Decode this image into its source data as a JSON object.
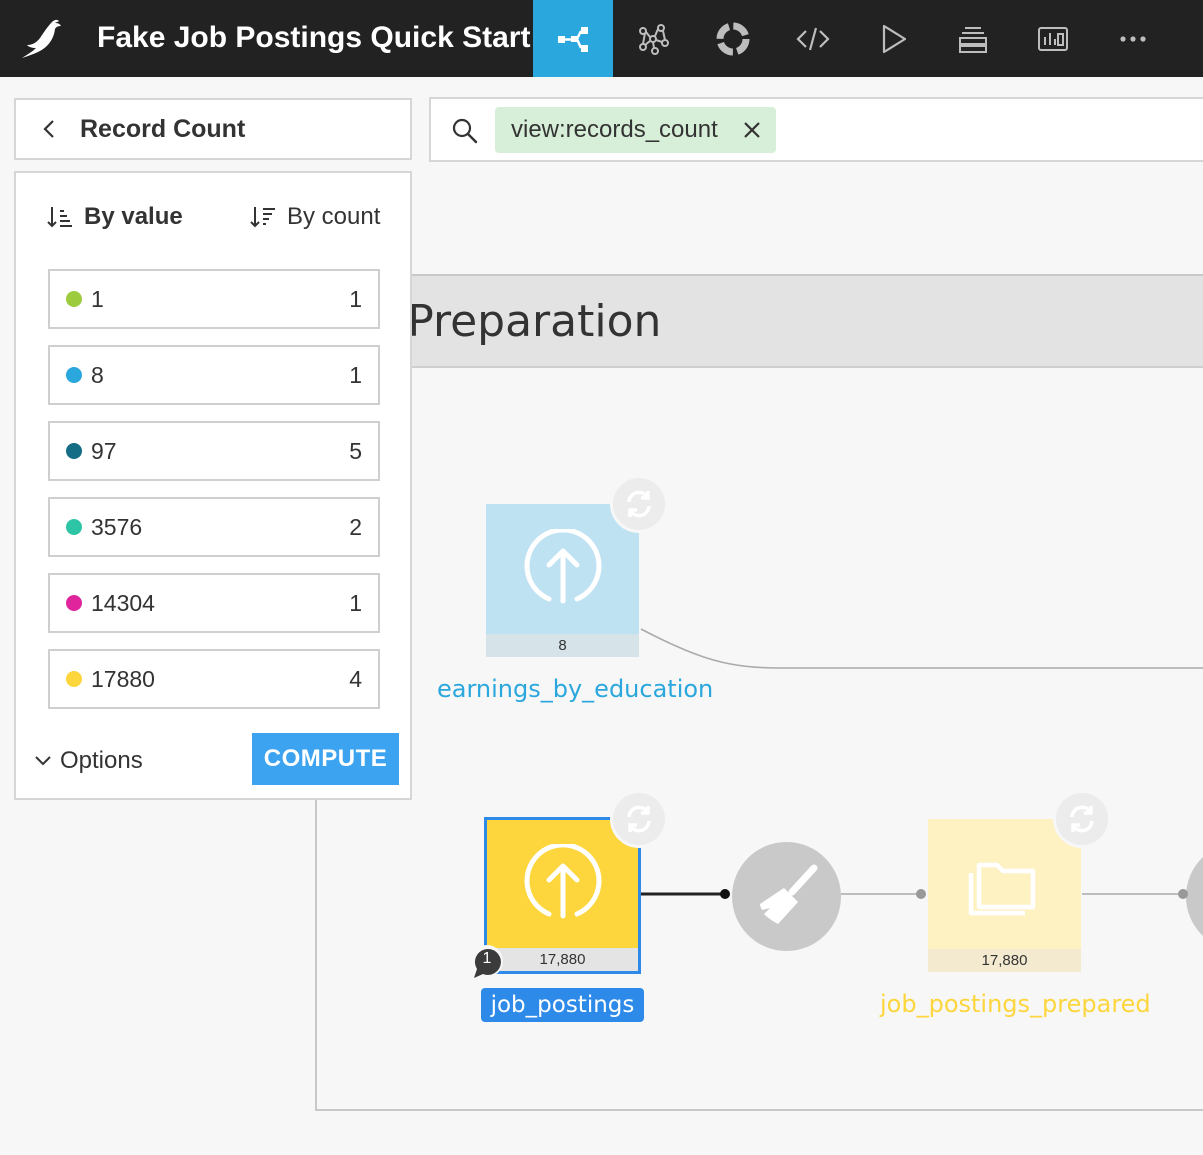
{
  "header": {
    "project_title": "Fake Job Postings Quick Start",
    "nav": [
      {
        "id": "flow",
        "icon": "flow-icon",
        "active": true
      },
      {
        "id": "lab",
        "icon": "lab-network-icon",
        "active": false
      },
      {
        "id": "jobs",
        "icon": "lifebuoy-icon",
        "active": false
      },
      {
        "id": "code",
        "icon": "code-icon",
        "active": false
      },
      {
        "id": "run",
        "icon": "play-icon",
        "active": false
      },
      {
        "id": "wiki",
        "icon": "stack-icon",
        "active": false
      },
      {
        "id": "dashboards",
        "icon": "dashboard-icon",
        "active": false
      },
      {
        "id": "more",
        "icon": "more-icon",
        "active": false
      }
    ]
  },
  "panel": {
    "title": "Record Count",
    "sort_by_value": "By value",
    "sort_by_count": "By count",
    "values": [
      {
        "label": "1",
        "count": "1",
        "color": "#9ccc3d"
      },
      {
        "label": "8",
        "count": "1",
        "color": "#2aa7dd"
      },
      {
        "label": "97",
        "count": "5",
        "color": "#156c85"
      },
      {
        "label": "3576",
        "count": "2",
        "color": "#2ec5a7"
      },
      {
        "label": "14304",
        "count": "1",
        "color": "#e0259c"
      },
      {
        "label": "17880",
        "count": "4",
        "color": "#fcd63c"
      }
    ],
    "options_label": "Options",
    "compute_label": "COMPUTE"
  },
  "search": {
    "chip": "view:records_count"
  },
  "flow": {
    "zone_title": "ta Preparation",
    "datasets": [
      {
        "name": "earnings_by_education",
        "count": "8",
        "color": "#2aa7dd"
      },
      {
        "name": "job_postings",
        "count": "17,880",
        "color": "#fcd63c"
      },
      {
        "name": "job_postings_prepared",
        "count": "17,880",
        "color": "#fcd63c"
      }
    ],
    "comment_count": "1"
  }
}
